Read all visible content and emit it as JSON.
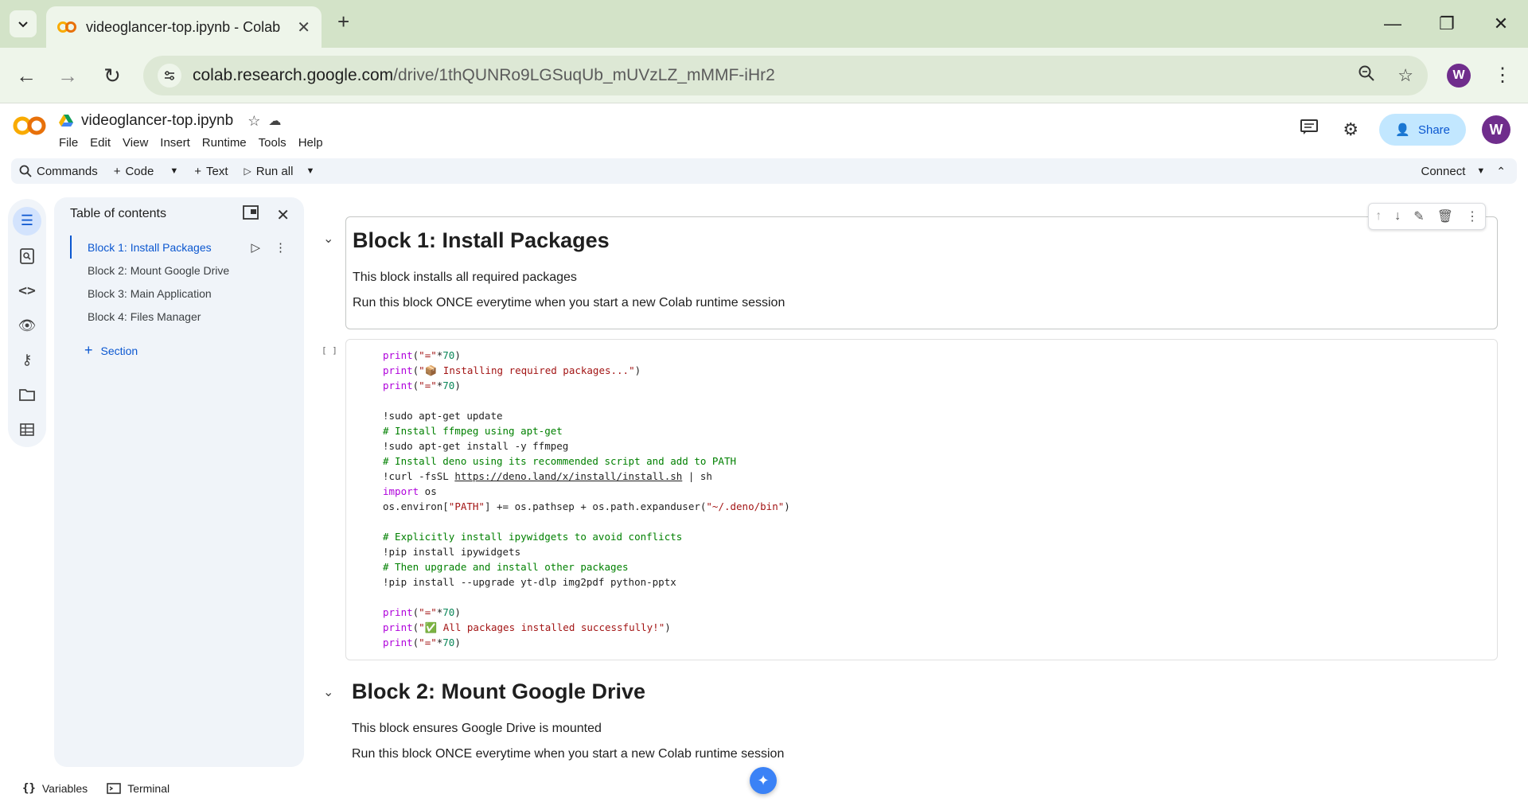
{
  "browser": {
    "tab_title": "videoglancer-top.ipynb - Colab",
    "url_host": "colab.research.google.com",
    "url_path": "/drive/1thQUNRo9LGSuqUb_mUVzLZ_mMMF-iHr2",
    "profile_initial": "W"
  },
  "colab": {
    "notebook_title": "videoglancer-top.ipynb",
    "menus": [
      "File",
      "Edit",
      "View",
      "Insert",
      "Runtime",
      "Tools",
      "Help"
    ],
    "share_label": "Share",
    "avatar_initial": "W",
    "toolbar": {
      "commands": "Commands",
      "code": "Code",
      "text": "Text",
      "run_all": "Run all",
      "connect": "Connect"
    }
  },
  "toc": {
    "title": "Table of contents",
    "items": [
      {
        "label": "Block 1: Install Packages",
        "active": true
      },
      {
        "label": "Block 2: Mount Google Drive",
        "active": false
      },
      {
        "label": "Block 3: Main Application",
        "active": false
      },
      {
        "label": "Block 4: Files Manager",
        "active": false
      }
    ],
    "section_label": "Section"
  },
  "cells": {
    "block1": {
      "heading": "Block 1: Install Packages",
      "p1": "This block installs all required packages",
      "p2": "Run this block ONCE everytime when you start a new Colab runtime session"
    },
    "exec_count": "[ ]",
    "code_lines": [
      "print(\"=\"*70)",
      "print(\"📦 Installing required packages...\")",
      "print(\"=\"*70)",
      "",
      "!sudo apt-get update",
      "# Install ffmpeg using apt-get",
      "!sudo apt-get install -y ffmpeg",
      "# Install deno using its recommended script and add to PATH",
      "!curl -fsSL https://deno.land/x/install/install.sh | sh",
      "import os",
      "os.environ[\"PATH\"] += os.pathsep + os.path.expanduser(\"~/.deno/bin\")",
      "",
      "# Explicitly install ipywidgets to avoid conflicts",
      "!pip install ipywidgets",
      "# Then upgrade and install other packages",
      "!pip install --upgrade yt-dlp img2pdf python-pptx",
      "",
      "print(\"=\"*70)",
      "print(\"✅ All packages installed successfully!\")",
      "print(\"=\"*70)"
    ],
    "block2": {
      "heading": "Block 2: Mount Google Drive",
      "p1": "This block ensures Google Drive is mounted",
      "p2": "Run this block ONCE everytime when you start a new Colab runtime session"
    }
  },
  "status": {
    "variables": "Variables",
    "terminal": "Terminal"
  }
}
